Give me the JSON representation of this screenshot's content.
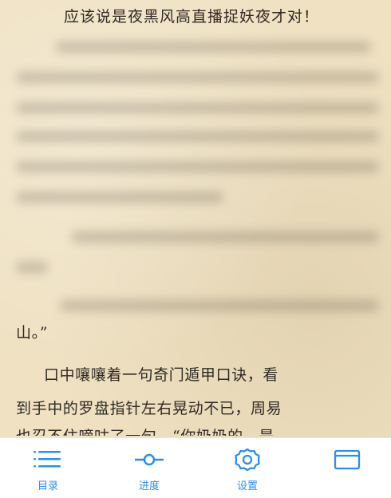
{
  "reader": {
    "title_line": "应该说是夜黑风高直播捉妖夜才对！",
    "line_shan": "山。”",
    "line_p1": "口中嚷嚷着一句奇门遁甲口诀，看",
    "line_p2": "到手中的罗盘指针左右晃动不已，周易",
    "line_p3": "也忍不住嘀咕了一句。“你奶奶的，是"
  },
  "toolbar": {
    "menu_label": "目录",
    "progress_label": "进度",
    "settings_label": "设置"
  },
  "colors": {
    "paper": "#efe1c2",
    "toolbar_accent": "#2f8fe0",
    "text": "#2e2a24"
  },
  "icons": [
    "list-icon",
    "progress-icon",
    "gear-icon",
    "more-icon"
  ]
}
